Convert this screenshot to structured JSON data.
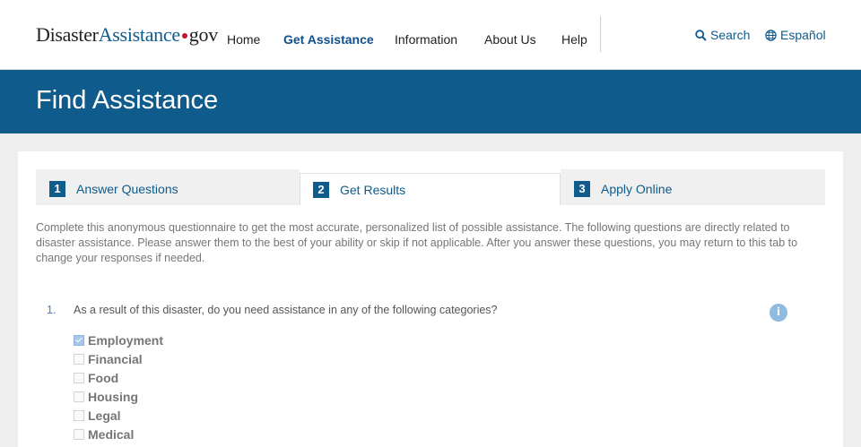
{
  "header": {
    "logo": {
      "part1": "Disaster",
      "part2": "Assistance",
      "part3": "gov"
    },
    "nav": [
      {
        "label": "Home",
        "active": false
      },
      {
        "label": "Get Assistance",
        "active": true
      },
      {
        "label": "Information",
        "active": false
      },
      {
        "label": "About Us",
        "active": false
      },
      {
        "label": "Help",
        "active": false
      }
    ],
    "search_label": "Search",
    "language_label": "Español"
  },
  "banner": {
    "title": "Find Assistance"
  },
  "tabs": [
    {
      "number": "1",
      "label": "Answer Questions",
      "active": false
    },
    {
      "number": "2",
      "label": "Get Results",
      "active": true
    },
    {
      "number": "3",
      "label": "Apply Online",
      "active": false
    }
  ],
  "intro": "Complete this anonymous questionnaire to get the most accurate, personalized list of possible assistance. The following questions are directly related to disaster assistance. Please answer them to the best of your ability or skip if not applicable. After you answer these questions, you may return to this tab to change your responses if needed.",
  "question": {
    "number": "1.",
    "text": "As a result of this disaster, do you need assistance in any of the following categories?",
    "info_icon": "i",
    "options": [
      {
        "label": "Employment",
        "checked": true
      },
      {
        "label": "Financial",
        "checked": false
      },
      {
        "label": "Food",
        "checked": false
      },
      {
        "label": "Housing",
        "checked": false
      },
      {
        "label": "Legal",
        "checked": false
      },
      {
        "label": "Medical",
        "checked": false
      }
    ]
  },
  "colors": {
    "brand_blue": "#0f5b8c",
    "logo_dot_red": "#c8102e",
    "info_icon": "#8fbbe0"
  }
}
